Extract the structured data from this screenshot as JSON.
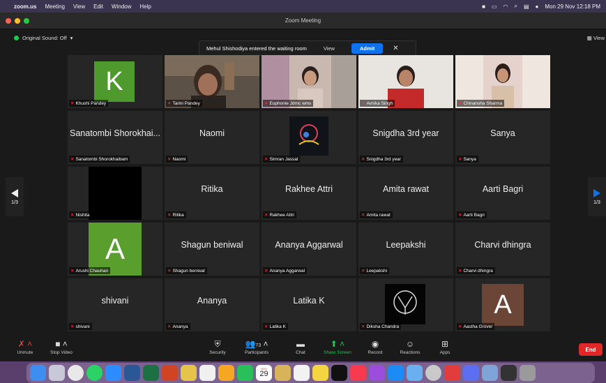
{
  "menubar": {
    "app": "zoom.us",
    "items": [
      "Meeting",
      "View",
      "Edit",
      "Window",
      "Help"
    ],
    "datetime": "Mon 29 Nov  12:18 PM"
  },
  "window": {
    "title": "Zoom Meeting"
  },
  "top": {
    "original_sound": "Original Sound: Off",
    "view_label": "View"
  },
  "notification": {
    "text": "Mehul Shishodiya entered the waiting room",
    "view_label": "View",
    "admit_label": "Admit",
    "close": "✕"
  },
  "participants": [
    {
      "label": "Khushi Pandey",
      "center": "",
      "avatar": "K",
      "avatar_color": "#4f9a2c"
    },
    {
      "label": "Tarini Pandey",
      "center": "",
      "video": true,
      "active": true
    },
    {
      "label": "Euphonie Jdmc wms",
      "center": "",
      "video": true
    },
    {
      "label": "Avnika Singh",
      "center": "",
      "video": true
    },
    {
      "label": "Chinansha Sharma",
      "center": "",
      "video": true
    },
    {
      "label": "Sanatombi Shorokhaibam",
      "center": "Sanatombi Shorokhai..."
    },
    {
      "label": "Naomi",
      "center": "Naomi"
    },
    {
      "label": "Simran Jassal",
      "center": "",
      "image": true
    },
    {
      "label": "Snigdha 3rd year",
      "center": "Snigdha 3rd year"
    },
    {
      "label": "Sanya",
      "center": "Sanya"
    },
    {
      "label": "Nishita",
      "center": "",
      "black": true
    },
    {
      "label": "Ritika",
      "center": "Ritika"
    },
    {
      "label": "Rakhee Attri",
      "center": "Rakhee Attri"
    },
    {
      "label": "Amita rawat",
      "center": "Amita rawat"
    },
    {
      "label": "Aarti Bagri",
      "center": "Aarti Bagri"
    },
    {
      "label": "Arushi Chauhan",
      "center": "",
      "avatar": "A",
      "avatar_color": "#5a9e2e"
    },
    {
      "label": "Shagun beniwal",
      "center": "Shagun beniwal"
    },
    {
      "label": "Ananya Aggarwal",
      "center": "Ananya Aggarwal"
    },
    {
      "label": "Leepakshi",
      "center": "Leepakshi"
    },
    {
      "label": "Charvi dhingra",
      "center": "Charvi dhingra"
    },
    {
      "label": "shivani",
      "center": "shivani"
    },
    {
      "label": "Ananya",
      "center": "Ananya"
    },
    {
      "label": "Latika K",
      "center": "Latika K"
    },
    {
      "label": "Diksha Chandra",
      "center": "",
      "logo": true
    },
    {
      "label": "Aastha Grover",
      "center": "",
      "avatar": "A",
      "avatar_color": "#6b4536"
    }
  ],
  "pager": {
    "page": "1/3"
  },
  "toolbar": {
    "unmute": "Unmute",
    "stop_video": "Stop Video",
    "security": "Security",
    "participants": "Participants",
    "participant_count": "73",
    "chat": "Chat",
    "share_screen": "Share Screen",
    "record": "Record",
    "reactions": "Reactions",
    "apps": "Apps",
    "end": "End"
  },
  "dock": {
    "calendar_day": "29",
    "calendar_month": "NOV"
  },
  "colors": {
    "accent": "#0e72ed",
    "active_speaker": "#c8d94f",
    "end": "#e02828",
    "share": "#23c552"
  }
}
